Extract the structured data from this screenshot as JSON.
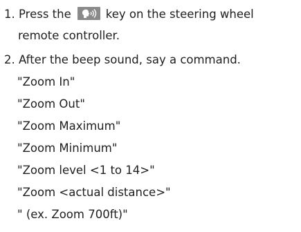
{
  "instructions": {
    "step1": {
      "text_before_icon": "1. Press the",
      "icon": "voice-recognition-key-icon",
      "text_after_icon": "key on the steering wheel",
      "continuation": "remote controller."
    },
    "step2": {
      "text": "2. After the beep sound, say a command."
    },
    "commands": [
      "\"Zoom In\"",
      "\"Zoom Out\"",
      "\"Zoom Maximum\"",
      "\"Zoom Minimum\"",
      "\"Zoom level <1 to 14>\"",
      "\"Zoom <actual distance>\"",
      "\" (ex. Zoom 700ft)\""
    ]
  },
  "colors": {
    "text": "#1e1e1e",
    "icon_background": "#8a8a8a",
    "icon_foreground": "#ffffff"
  }
}
